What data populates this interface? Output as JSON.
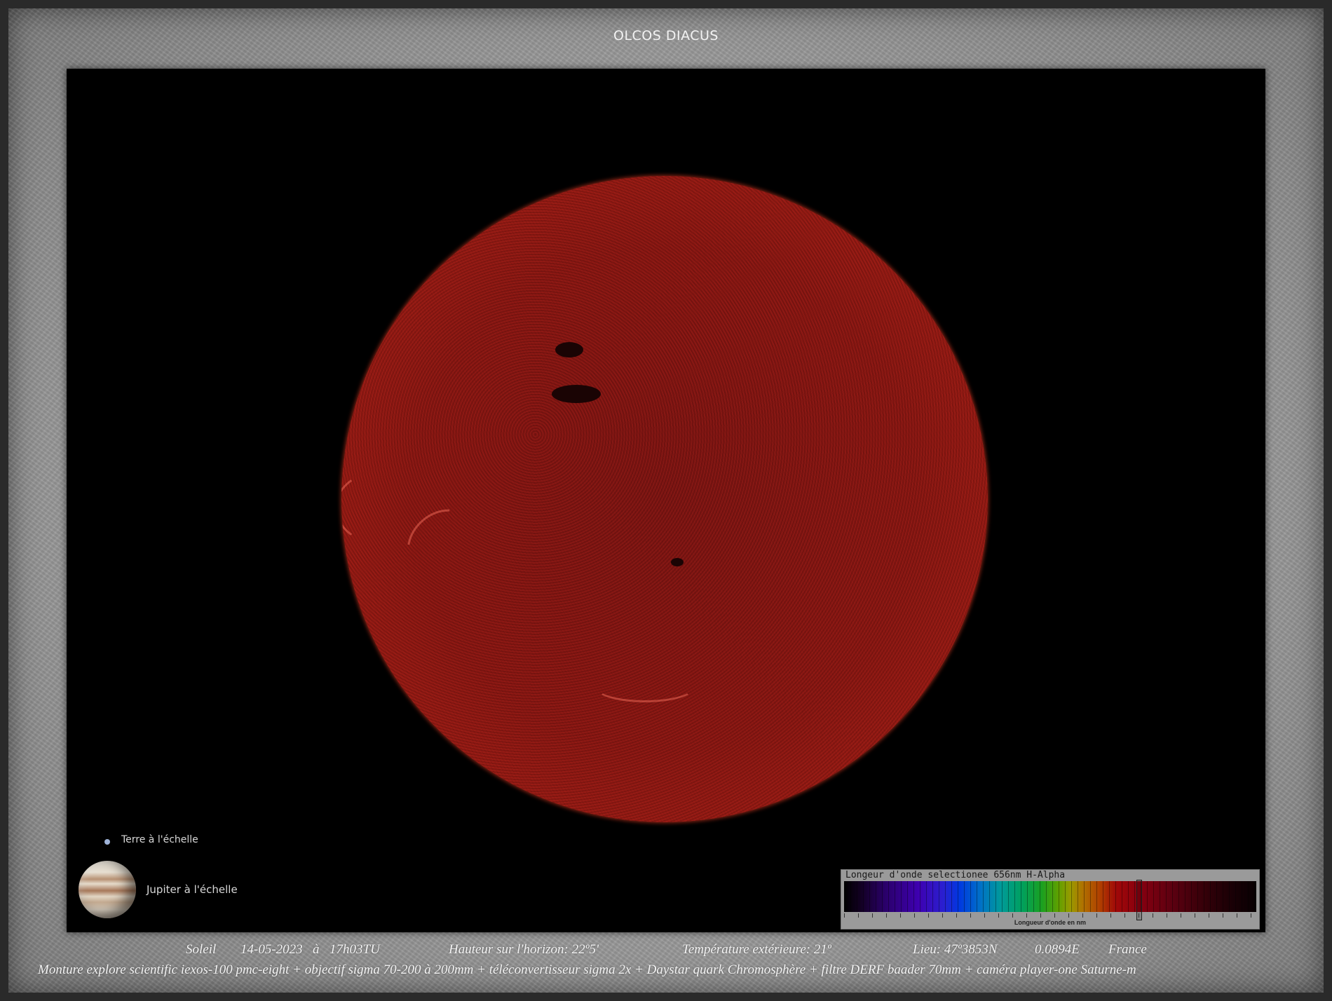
{
  "header": {
    "title": "OLCOS DIACUS"
  },
  "legend": {
    "earth_label": "Terre à l'échelle",
    "jupiter_label": "Jupiter à l'échelle"
  },
  "spectrum": {
    "title": "Longeur d'onde selectionee 656nm H-Alpha",
    "axis_label": "Longueur d'onde en nm"
  },
  "caption": {
    "object": "Soleil",
    "date": "14-05-2023",
    "at": "à",
    "time": "17h03TU",
    "altitude": "Hauteur sur l'horizon: 22º5'",
    "temperature": "Température extérieure: 21º",
    "location": "Lieu: 47º3853N",
    "longitude": "0.0894E",
    "country": "France",
    "equipment": "Monture explore scientific iexos-100 pmc-eight  +  objectif  sigma  70-200 à 200mm  +  téléconvertisseur sigma 2x +  Daystar quark Chromosphère  +  filtre DERF baader 70mm +  caméra player-one Saturne-m"
  },
  "colors": {
    "sun_core": "#8a1712",
    "sun_limb": "#ff5a30",
    "background": "#000000",
    "frame": "#9c9c9c"
  }
}
